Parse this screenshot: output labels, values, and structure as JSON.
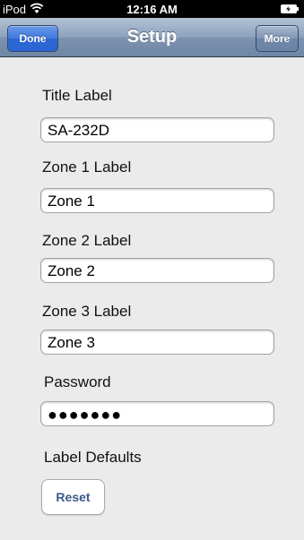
{
  "status_bar": {
    "carrier": "iPod",
    "time": "12:16 AM"
  },
  "nav": {
    "title": "Setup",
    "done_label": "Done",
    "more_label": "More"
  },
  "form": {
    "title_label": "Title Label",
    "title_value": "SA-232D",
    "zone1_label": "Zone 1 Label",
    "zone1_value": "Zone 1",
    "zone2_label": "Zone 2 Label",
    "zone2_value": "Zone 2",
    "zone3_label": "Zone 3 Label",
    "zone3_value": "Zone 3",
    "password_label": "Password",
    "password_value": "●●●●●●●",
    "defaults_label": "Label Defaults",
    "reset_label": "Reset"
  },
  "icons": {
    "wifi": "wifi-icon",
    "battery": "battery-icon"
  },
  "colors": {
    "nav_bar": "#8da2bd",
    "done_button": "#3f78de",
    "background": "#ebebeb",
    "reset_text": "#3a5a8a"
  }
}
